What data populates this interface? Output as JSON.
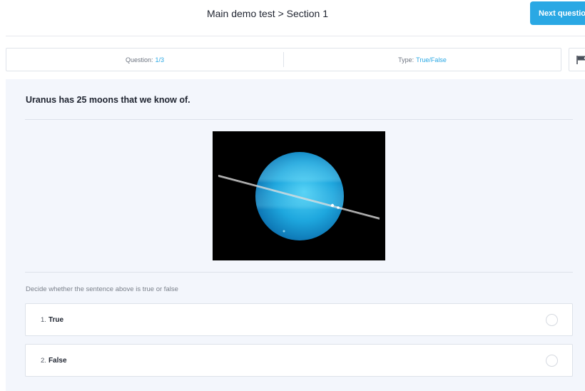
{
  "header": {
    "title": "Main demo test > Section 1",
    "next_label": "Next question"
  },
  "info": {
    "question_label": "Question:",
    "question_value": "1/3",
    "type_label": "Type:",
    "type_value": "True/False"
  },
  "icons": {
    "flag": "flag-icon"
  },
  "question": {
    "text": "Uranus has 25 moons that we know of.",
    "instruction": "Decide whether the sentence above is true or false",
    "options": [
      {
        "number": "1.",
        "label": "True",
        "selected": false
      },
      {
        "number": "2.",
        "label": "False",
        "selected": false
      }
    ]
  },
  "colors": {
    "accent": "#2aa8e4",
    "panel_bg": "#f3f6fc"
  }
}
